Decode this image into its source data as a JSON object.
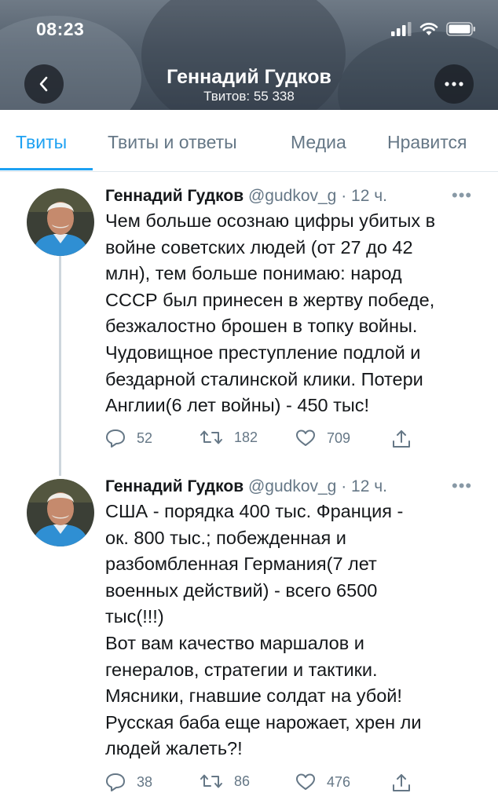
{
  "status_bar": {
    "time": "08:23"
  },
  "header": {
    "title": "Геннадий Гудков",
    "subtitle": "Твитов: 55 338"
  },
  "tabs": [
    {
      "label": "Твиты",
      "active": true
    },
    {
      "label": "Твиты и ответы",
      "active": false
    },
    {
      "label": "Медиа",
      "active": false
    },
    {
      "label": "Нравится",
      "active": false
    }
  ],
  "tweets": [
    {
      "name": "Геннадий Гудков",
      "meta": "@gudkov_g · 12 ч.",
      "lines": [
        "Чем больше осознаю цифры убитых в",
        "войне советских людей (от 27 до 42",
        "млн), тем больше понимаю: народ",
        "СССР был принесен в жертву победе,",
        "безжалостно брошен в топку войны.",
        "Чудовищное преступление подлой и",
        "бездарной сталинской клики. Потери",
        "Англии(6 лет войны) - 450 тыс!"
      ],
      "replies": "52",
      "retweets": "182",
      "likes": "709"
    },
    {
      "name": "Геннадий Гудков",
      "meta": "@gudkov_g · 12 ч.",
      "lines": [
        "США - порядка 400 тыс.  Франция -",
        "ок. 800 тыс.; побежденная и",
        "разбомбленная Германия(7 лет",
        "военных действий) - всего 6500",
        "тыс(!!!)",
        "Вот вам качество маршалов и",
        "генералов, стратегии и тактики.",
        "Мясники, гнавшие солдат на убой!",
        "Русская баба еще нарожает, хрен ли",
        "людей жалеть?!"
      ],
      "replies": "38",
      "retweets": "86",
      "likes": "476"
    }
  ],
  "colors": {
    "accent": "#1da1f2",
    "secondary_text": "#657786",
    "text": "#14171a"
  },
  "icons": [
    "back-icon",
    "more-icon",
    "signal-icon",
    "wifi-icon",
    "battery-icon",
    "reply-icon",
    "retweet-icon",
    "like-icon",
    "share-icon"
  ]
}
